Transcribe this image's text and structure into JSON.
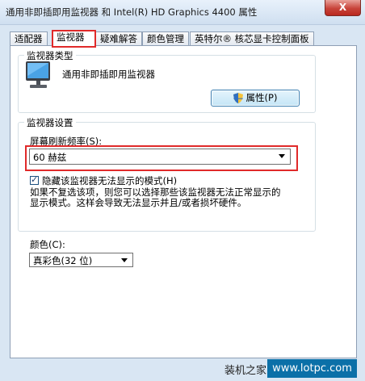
{
  "window": {
    "title": "通用非即插即用监视器 和 Intel(R) HD Graphics 4400 属性",
    "close_label": "X"
  },
  "tabs": [
    {
      "label": "适配器"
    },
    {
      "label": "监视器"
    },
    {
      "label": "疑难解答"
    },
    {
      "label": "颜色管理"
    },
    {
      "label": "英特尔® 核芯显卡控制面板"
    }
  ],
  "monitor_type": {
    "group_label": "监视器类型",
    "monitor_name": "通用非即插即用监视器",
    "properties_button": "属性(P)"
  },
  "monitor_settings": {
    "group_label": "监视器设置",
    "refresh_label": "屏幕刷新频率(S):",
    "refresh_value": "60 赫兹",
    "hide_modes_checked": true,
    "hide_modes_label": "隐藏该监视器无法显示的模式(H)",
    "hide_modes_desc_line1": "如果不复选该项，则您可以选择那些该监视器无法正常显示的",
    "hide_modes_desc_line2": "显示模式。这样会导致无法显示并且/或者损坏硬件。"
  },
  "colors": {
    "label": "颜色(C):",
    "value": "真彩色(32 位)"
  },
  "watermark": {
    "cn": "装机之家",
    "url": "www.lotpc.com"
  },
  "theme": {
    "highlight": "#e02a2a",
    "titlebar": "#d9e6f3"
  }
}
